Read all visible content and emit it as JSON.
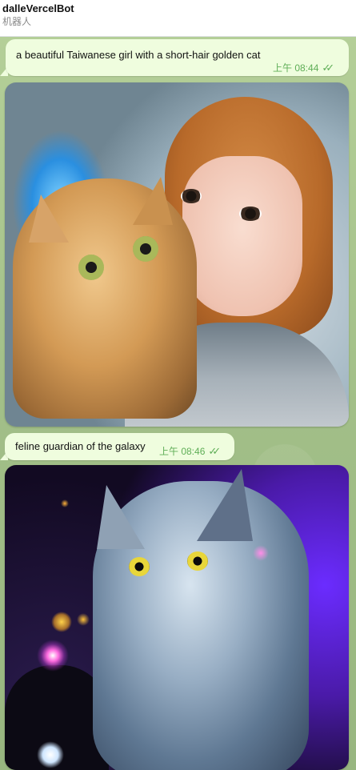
{
  "header": {
    "title": "dalleVercelBot",
    "subtitle": "机器人"
  },
  "messages": [
    {
      "text": "a beautiful Taiwanese girl with a short-hair golden cat",
      "time": "上午 08:44",
      "status_icon": "double-check-icon"
    },
    {
      "text": "feline guardian of the galaxy",
      "time": "上午 08:46",
      "status_icon": "double-check-icon"
    }
  ],
  "colors": {
    "bubble_bg": "#effdde",
    "time_color": "#5fae57",
    "chat_bg": "#a6c28c"
  }
}
